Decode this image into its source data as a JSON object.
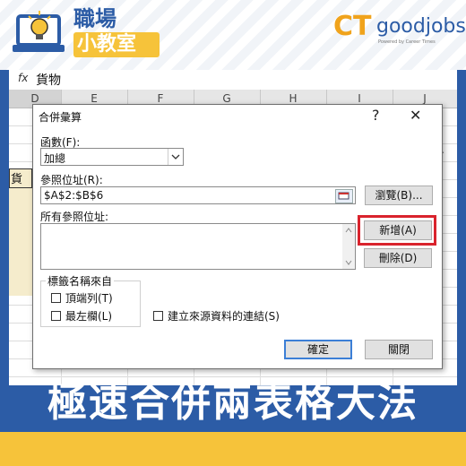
{
  "header": {
    "brand_line1": "職場",
    "brand_line2": "小教室",
    "ct_logo": "CT",
    "goodjobs": "goodjobs",
    "powered_by": "Powered by Career Times"
  },
  "excel": {
    "formula_bar_fx": "fx",
    "formula_bar_text": "貨物",
    "columns": [
      "D",
      "E",
      "F",
      "G",
      "H",
      "I",
      "J"
    ],
    "cell_fragment": "貨物"
  },
  "dialog": {
    "title": "合併彙算",
    "help": "?",
    "close": "✕",
    "function_label": "函數(F):",
    "function_value": "加總",
    "reference_label": "參照位址(R):",
    "reference_value": "$A$2:$B$6",
    "browse_button": "瀏覽(B)...",
    "all_references_label": "所有參照位址:",
    "add_button": "新增(A)",
    "delete_button": "刪除(D)",
    "use_labels_label": "標籤名稱來自",
    "top_row_label": "頂端列(T)",
    "left_column_label": "最左欄(L)",
    "create_links_label": "建立來源資料的連結(S)",
    "ok_button": "確定",
    "close_button": "關閉"
  },
  "banner": {
    "title": "極速合併兩表格大法"
  },
  "colors": {
    "brand_blue": "#2c5ca6",
    "brand_yellow": "#f6c33a",
    "highlight_red": "#d9232d"
  }
}
